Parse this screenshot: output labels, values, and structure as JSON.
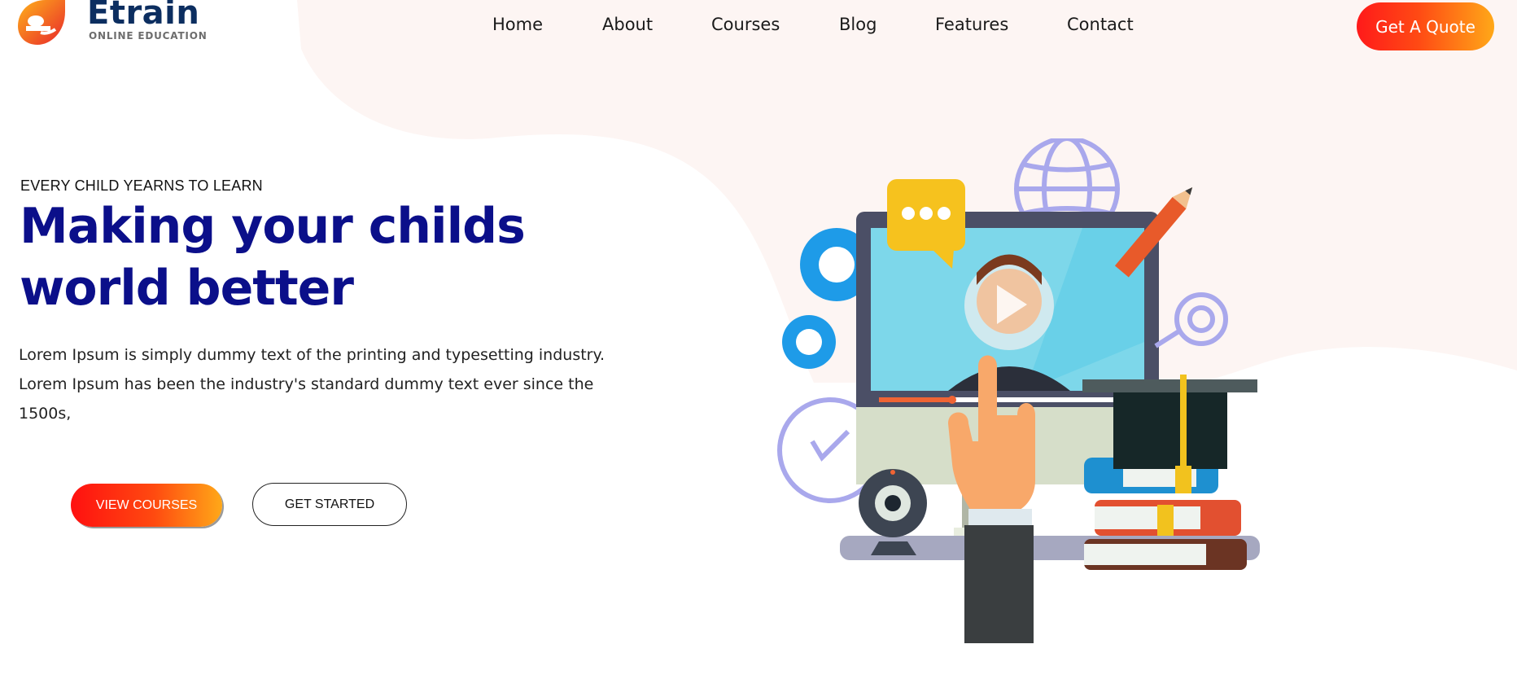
{
  "brand": {
    "name": "Etrain",
    "tagline": "ONLINE EDUCATION",
    "colors": {
      "navy": "#0c2e60",
      "orange": "#f26b1d",
      "red": "#ff1a1a",
      "headline": "#0b0f8a"
    }
  },
  "nav": {
    "items": [
      {
        "label": "Home"
      },
      {
        "label": "About"
      },
      {
        "label": "Courses"
      },
      {
        "label": "Blog"
      },
      {
        "label": "Features"
      },
      {
        "label": "Contact"
      }
    ],
    "cta_label": "Get A Quote"
  },
  "hero": {
    "eyebrow": "EVERY CHILD YEARNS TO LEARN",
    "headline": "Making your childs world better",
    "lede": "Lorem Ipsum is simply dummy text of the printing and typesetting industry. Lorem Ipsum has been the industry's standard dummy text ever since the 1500s,",
    "primary_button": "VIEW COURSES",
    "secondary_button": "GET STARTED",
    "illustration_icon": "e-learning-illustration-icon"
  }
}
